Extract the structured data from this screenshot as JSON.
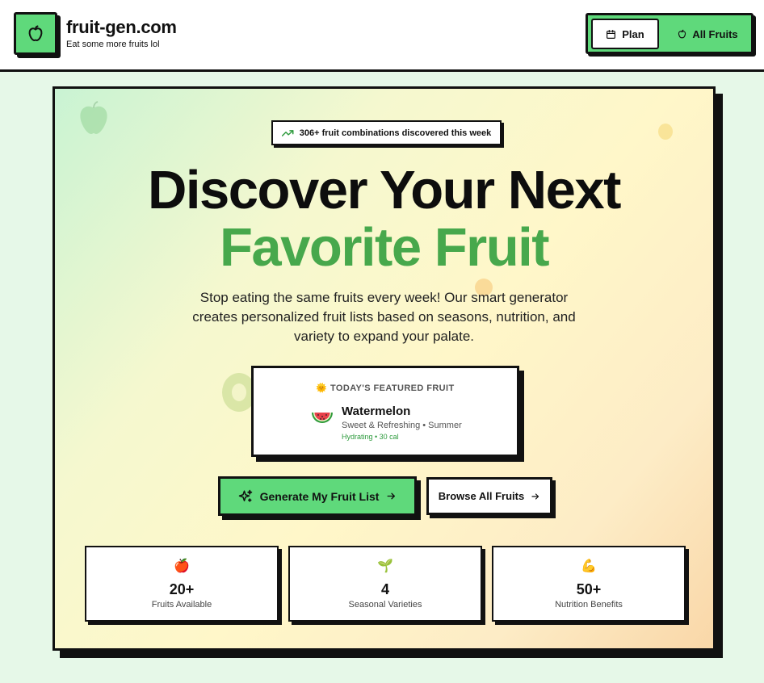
{
  "header": {
    "brand_title": "fruit-gen.com",
    "brand_subtitle": "Eat some more fruits lol",
    "logo_icon": "apple-icon",
    "nav": {
      "plan_label": "Plan",
      "plan_icon": "calendar-icon",
      "all_fruits_label": "All Fruits",
      "all_fruits_icon": "apple-icon"
    }
  },
  "hero": {
    "badge_text": "306+ fruit combinations discovered this week",
    "badge_icon": "trending-up-icon",
    "headline_line1": "Discover Your Next",
    "headline_line2": "Favorite Fruit",
    "lead": "Stop eating the same fruits every week! Our smart generator creates personalized fruit lists based on seasons, nutrition, and variety to expand your palate.",
    "featured": {
      "label_emoji": "🌞",
      "label": "TODAY'S FEATURED FRUIT",
      "emoji": "🍉",
      "name": "Watermelon",
      "description": "Sweet & Refreshing • Summer",
      "meta": "Hydrating • 30 cal"
    },
    "primary_button": {
      "label": "Generate My Fruit List",
      "icon": "sparkles-icon",
      "trailing_icon": "arrow-right-icon"
    },
    "secondary_button": {
      "label": "Browse All Fruits",
      "trailing_icon": "arrow-right-icon"
    },
    "stats": [
      {
        "emoji": "🍎",
        "value": "20+",
        "label": "Fruits Available"
      },
      {
        "emoji": "🌱",
        "value": "4",
        "label": "Seasonal Varieties"
      },
      {
        "emoji": "💪",
        "value": "50+",
        "label": "Nutrition Benefits"
      }
    ]
  },
  "colors": {
    "accent_green": "#5fd97b",
    "headline_green": "#47a84c",
    "ink": "#111111",
    "page_background": "#e6f8e8"
  }
}
